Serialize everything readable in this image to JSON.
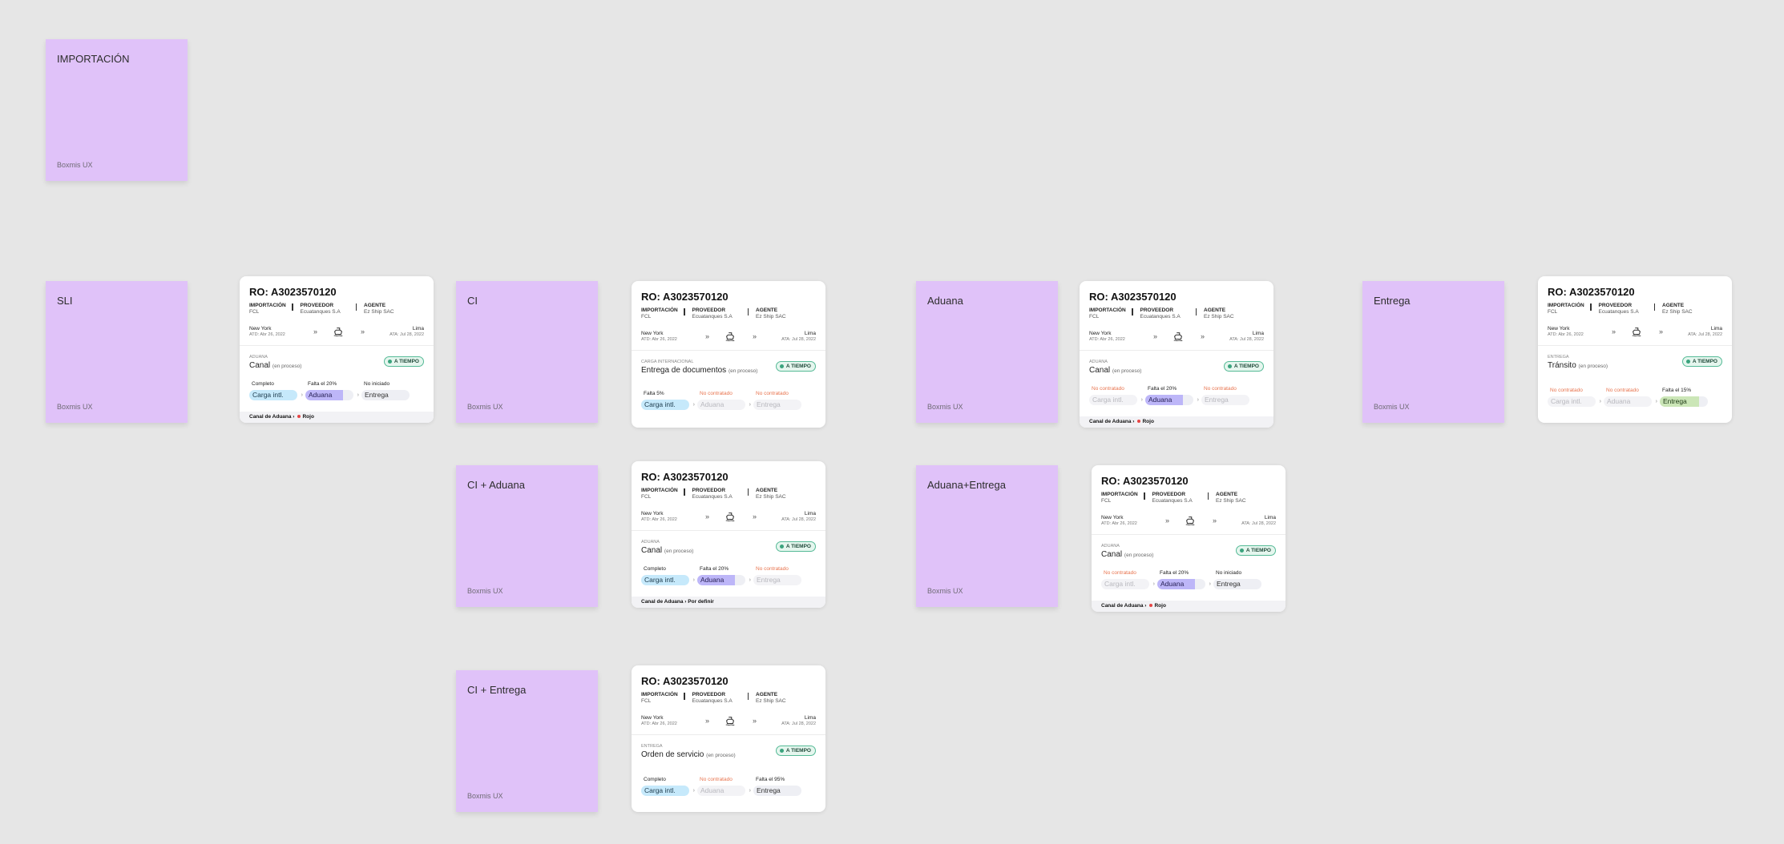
{
  "stickies": [
    {
      "title": "IMPORTACIÓN",
      "footer": "Boxmis UX"
    },
    {
      "title": "SLI",
      "footer": "Boxmis UX"
    },
    {
      "title": "CI",
      "footer": "Boxmis UX"
    },
    {
      "title": "Aduana",
      "footer": "Boxmis UX"
    },
    {
      "title": "Entrega",
      "footer": "Boxmis UX"
    },
    {
      "title": "CI + Aduana",
      "footer": "Boxmis UX"
    },
    {
      "title": "Aduana+Entrega",
      "footer": "Boxmis UX"
    },
    {
      "title": "CI + Entrega",
      "footer": "Boxmis UX"
    }
  ],
  "common": {
    "ro": "RO: A3023570120",
    "importacion_label": "IMPORTACIÓN",
    "importacion_value": "FCL",
    "proveedor_label": "PROVEEDOR",
    "proveedor_value": "Ecuatanques S.A",
    "agente_label": "AGENTE",
    "agente_value": "Ez Ship SAC",
    "origin_city": "New York",
    "origin_date": "ATD: Abr 26, 2022",
    "dest_city": "Lima",
    "dest_date": "ATA: Jul 28, 2022",
    "badge": "A TIEMPO",
    "chevron": "»",
    "step_arrow": "›",
    "footer_label": "Canal de Aduana ›",
    "step1": "Carga intl.",
    "step2": "Aduana",
    "step3": "Entrega"
  },
  "cards": [
    {
      "stage": "ADUANA",
      "name": "Canal",
      "sub": "(en proceso)",
      "s1": "Completo",
      "s2": "Falta el 20%",
      "s3": "No iniciado",
      "footer_value": "Rojo"
    },
    {
      "stage": "CARGA INTERNACIONAL",
      "name": "Entrega de documentos",
      "sub": "(en proceso)",
      "s1": "Falta 5%",
      "s2": "No contratado",
      "s3": "No contratado"
    },
    {
      "stage": "ADUANA",
      "name": "Canal",
      "sub": "(en proceso)",
      "s1": "No contratado",
      "s2": "Falta el 20%",
      "s3": "No contratado",
      "footer_value": "Rojo"
    },
    {
      "stage": "ENTREGA",
      "name": "Tránsito",
      "sub": "(en proceso)",
      "s1": "No contratado",
      "s2": "No contratado",
      "s3": "Falta el 15%"
    },
    {
      "stage": "ADUANA",
      "name": "Canal",
      "sub": "(en proceso)",
      "s1": "Completo",
      "s2": "Falta el 20%",
      "s3": "No contratado",
      "footer_value": "Por definir"
    },
    {
      "stage": "ADUANA",
      "name": "Canal",
      "sub": "(en proceso)",
      "s1": "No contratado",
      "s2": "Falta el 20%",
      "s3": "No iniciado",
      "footer_value": "Rojo"
    },
    {
      "stage": "ENTREGA",
      "name": "Orden de servicio",
      "sub": "(en proceso)",
      "s1": "Completo",
      "s2": "No contratado",
      "s3": "Falta el 95%"
    }
  ],
  "colors": {
    "sticky": "#e0c2f9",
    "carga_active": "#c6e9fb",
    "aduana_active": "#bdb6f8",
    "entrega_active": "#cbe6b7",
    "badge_border": "#55ba96",
    "no_contratado": "#e8734d",
    "rojo": "#e64545"
  }
}
